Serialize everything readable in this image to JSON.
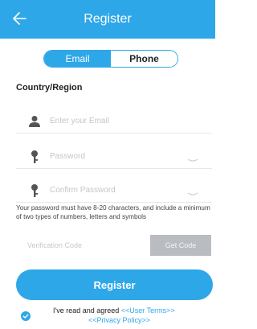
{
  "header": {
    "title": "Register",
    "back_icon": "arrow-left-icon"
  },
  "tabs": [
    {
      "label": "Email",
      "active": true
    },
    {
      "label": "Phone",
      "active": false
    }
  ],
  "region": {
    "label": "Country/Region"
  },
  "fields": {
    "email": {
      "placeholder": "Enter your Email",
      "icon": "user-icon"
    },
    "password": {
      "placeholder": "Password",
      "icon": "key-icon"
    },
    "confirm": {
      "placeholder": "Confirm Password",
      "icon": "key-icon"
    }
  },
  "hint": "Your password must have 8-20 characters, and include a minimum of two types of numbers, letters and symbols",
  "verification": {
    "placeholder": "Verification Code",
    "button_label": "Get Code"
  },
  "register_button": "Register",
  "agreement": {
    "prefix": "I've read and agreed ",
    "user_terms": "<<User Terms>>",
    "privacy_policy": "<<Privacy Policy>>"
  },
  "colors": {
    "accent": "#2ea7e8",
    "disabled_button": "#b9bcc0"
  }
}
